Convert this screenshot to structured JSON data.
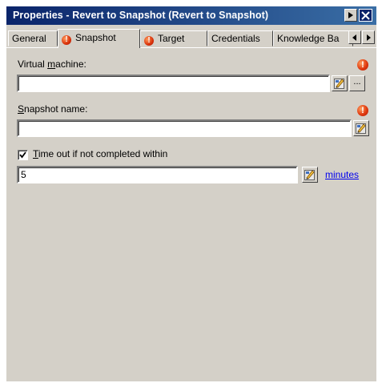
{
  "window": {
    "title": "Properties - Revert to Snapshot (Revert to Snapshot)"
  },
  "tabs": [
    {
      "label": "General",
      "warning": false,
      "active": false
    },
    {
      "label": "Snapshot",
      "warning": true,
      "active": true
    },
    {
      "label": "Target",
      "warning": true,
      "active": false
    },
    {
      "label": "Credentials",
      "warning": false,
      "active": false
    },
    {
      "label": "Knowledge Ba",
      "warning": false,
      "active": false
    }
  ],
  "form": {
    "vm_label_pre": "Virtual ",
    "vm_label_key": "m",
    "vm_label_post": "achine:",
    "vm_value": "",
    "browse_label": "...",
    "snapshot_label_key": "S",
    "snapshot_label_post": "napshot name:",
    "snapshot_value": "",
    "timeout_checked": true,
    "timeout_label_key": "T",
    "timeout_label_post": "ime out if not completed within",
    "timeout_value": "5",
    "timeout_unit": "minutes"
  },
  "icons": {
    "warning": "exclamation-circle-icon",
    "lookup": "pencil-picker-icon",
    "checkmark": "check-icon"
  },
  "colors": {
    "title_bar": "#0a246a",
    "dialog_bg": "#d4d0c8",
    "warning": "#e03a10",
    "link": "#0000ee"
  }
}
